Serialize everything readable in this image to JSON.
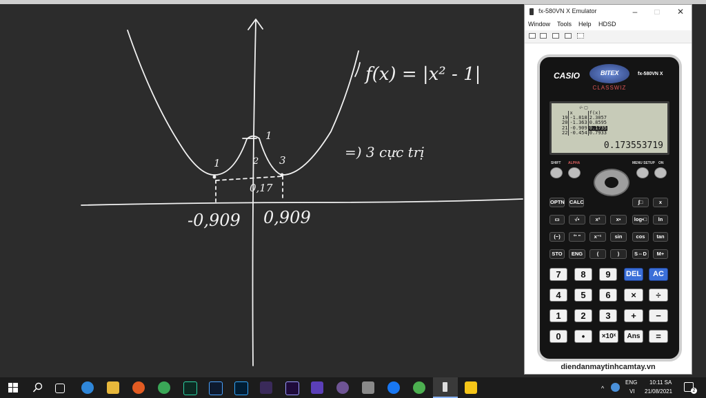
{
  "board": {
    "formula": "f(x) = |x² - 1|",
    "conclusion": "=) 3 cực trị",
    "labels": {
      "left_extremum": "1",
      "middle_extremum": "2",
      "right_extremum": "3",
      "peak_value": "1",
      "local_max_value": "0,17",
      "left_x": "-0,909",
      "right_x": "0,909"
    }
  },
  "emulator": {
    "title": "fx-580VN X Emulator",
    "menu": [
      "Window",
      "Tools",
      "Help",
      "HDSD"
    ],
    "footer": "diendanmaytinhcamtay.vn",
    "calculator": {
      "brand": "CASIO",
      "partner": "BITEX",
      "model": "fx-580VN X",
      "series": "CLASSWIZ",
      "screen": {
        "indicator": "√▫ ▢",
        "table_header": [
          "",
          "x",
          "f(x)"
        ],
        "rows": [
          [
            "19",
            "-1.818",
            "2.3057"
          ],
          [
            "20",
            "-1.363",
            "0.8595"
          ],
          [
            "21",
            "-0.909",
            "0.1735"
          ],
          [
            "22",
            "-0.454",
            "0.7933"
          ]
        ],
        "main_value": "0.173553719"
      },
      "top_labels": {
        "shift": "SHIFT",
        "alpha": "ALPHA",
        "menu": "MENU SETUP",
        "on": "ON"
      },
      "keys": {
        "r1": [
          "OPTN",
          "CALC",
          "∫□",
          "x"
        ],
        "r2": [
          "▭",
          "√▪",
          "x²",
          "x▪",
          "log▪□",
          "ln"
        ],
        "r3": [
          "(−)",
          "°' \"",
          "x⁻¹",
          "sin",
          "cos",
          "tan"
        ],
        "r4": [
          "STO",
          "ENG",
          "(",
          ")",
          "S⇔D",
          "M+"
        ],
        "r5": [
          "7",
          "8",
          "9",
          "DEL",
          "AC"
        ],
        "r6": [
          "4",
          "5",
          "6",
          "×",
          "÷"
        ],
        "r7": [
          "1",
          "2",
          "3",
          "+",
          "−"
        ],
        "r8": [
          "0",
          "•",
          "×10ˣ",
          "Ans",
          "="
        ]
      }
    }
  },
  "taskbar": {
    "lang": "ENG",
    "lang2": "VI",
    "time": "10:11 SA",
    "date": "21/08/2021",
    "notify_count": "2"
  }
}
